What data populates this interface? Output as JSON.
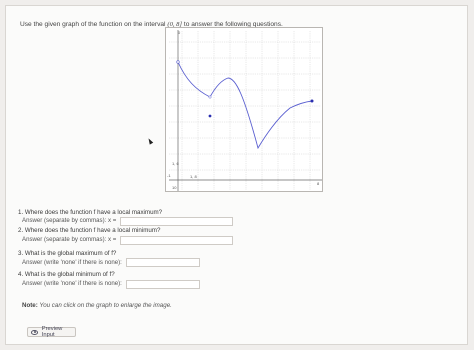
{
  "intro": {
    "before": "Use the given graph of the function on the interval",
    "interval": "(0, 8]",
    "after": "to answer the following questions."
  },
  "graph": {
    "tick_x": "1, 8",
    "tick_y": "1, 6",
    "tick_yb": "-1",
    "tick_ybot": "10",
    "tick_xr": "8",
    "tick_xl": "0"
  },
  "questions": [
    {
      "label": "1. Where does the function f have a local maximum?",
      "answer_label": "Answer (separate by commas): x =",
      "value": ""
    },
    {
      "label": "2. Where does the function f have a local minimum?",
      "answer_label": "Answer (separate by commas): x =",
      "value": ""
    },
    {
      "label": "3. What is the global maximum of f?",
      "answer_label": "Answer (write 'none' if there is none):",
      "value": ""
    },
    {
      "label": "4. What is the global minimum of f?",
      "answer_label": "Answer (write 'none' if there is none):",
      "value": ""
    }
  ],
  "note": {
    "bold": "Note:",
    "text": "You can click on the graph to enlarge the image."
  },
  "preview_button": "Preview Input",
  "colors": {
    "curve": "#5a5fd0",
    "grid": "#c9c9c9"
  }
}
